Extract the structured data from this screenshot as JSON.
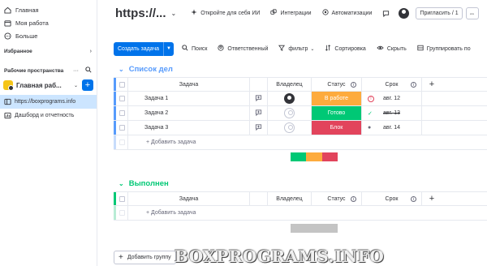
{
  "sidebar": {
    "nav": [
      {
        "label": "Главная",
        "icon": "home-icon"
      },
      {
        "label": "Моя работа",
        "icon": "calendar-icon"
      },
      {
        "label": "Больше",
        "icon": "more-icon"
      }
    ],
    "favorites_label": "Избранное",
    "workspaces_label": "Рабочие пространства",
    "workspace_name": "Главная раб...",
    "workspace_add": "+",
    "boards": [
      {
        "label": "https://boxprograms.info",
        "icon": "board-icon",
        "active": true
      },
      {
        "label": "Дашборд и отчетность",
        "icon": "dashboard-icon",
        "active": false
      }
    ]
  },
  "topbar": {
    "title": "https://...",
    "links": [
      {
        "label": "Откройте для себя ИИ",
        "icon": "ai-sparkle-icon"
      },
      {
        "label": "Интеграции",
        "icon": "integrations-icon"
      },
      {
        "label": "Автоматизации",
        "icon": "automations-icon"
      }
    ],
    "invite_label": "Пригласить / 1"
  },
  "toolbar": {
    "create_label": "Создать задача",
    "tools": [
      {
        "label": "Поиск",
        "icon": "search-icon"
      },
      {
        "label": "Ответственный",
        "icon": "person-icon"
      },
      {
        "label": "фильтр",
        "icon": "filter-icon"
      },
      {
        "label": "Сортировка",
        "icon": "sort-icon"
      },
      {
        "label": "Скрыть",
        "icon": "eye-icon"
      },
      {
        "label": "Группировать по",
        "icon": "group-icon"
      }
    ]
  },
  "colors": {
    "accent": "#0073ea",
    "group1": "#579bfc",
    "group2": "#00c875",
    "working": "#fdab3d",
    "done": "#00c875",
    "stuck": "#e2445c",
    "empty": "#c4c4c4"
  },
  "columns": {
    "task": "Задача",
    "owner": "Владелец",
    "status": "Статус",
    "date": "Срок"
  },
  "groups": [
    {
      "title": "Список дел",
      "rows": [
        {
          "task": "Задача 1",
          "owner": "filled",
          "status": "В работе",
          "status_color": "#fdab3d",
          "date": "авг. 12",
          "date_icon": "!",
          "date_strike": false
        },
        {
          "task": "Задача 2",
          "owner": "empty",
          "status": "Готово",
          "status_color": "#00c875",
          "date": "авг. 13",
          "date_icon": "✓",
          "date_strike": true
        },
        {
          "task": "Задача 3",
          "owner": "empty",
          "status": "Блок",
          "status_color": "#e2445c",
          "date": "авг. 14",
          "date_icon": "●",
          "date_strike": false
        }
      ],
      "add_label": "+ Добавить задача",
      "summary": [
        {
          "color": "#00c875",
          "fraction": 0.333
        },
        {
          "color": "#fdab3d",
          "fraction": 0.333
        },
        {
          "color": "#e2445c",
          "fraction": 0.334
        }
      ]
    },
    {
      "title": "Выполнен",
      "rows": [],
      "add_label": "+ Добавить задача",
      "summary": [
        {
          "color": "#c4c4c4",
          "fraction": 1.0
        }
      ]
    }
  ],
  "add_group_label": "Добавить группу",
  "watermark": "BOXPROGRAMS.INFO"
}
